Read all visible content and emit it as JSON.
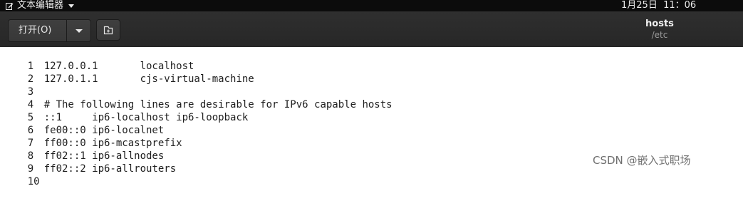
{
  "topbar": {
    "app_name": "文本编辑器",
    "clock": "1月25日  11：06"
  },
  "headerbar": {
    "open_label": "打开(O)",
    "title": "hosts",
    "subtitle": "/etc"
  },
  "editor": {
    "lines": [
      {
        "num": "1",
        "text": "127.0.0.1       localhost"
      },
      {
        "num": "2",
        "text": "127.0.1.1       cjs-virtual-machine"
      },
      {
        "num": "3",
        "text": ""
      },
      {
        "num": "4",
        "text": "# The following lines are desirable for IPv6 capable hosts"
      },
      {
        "num": "5",
        "text": "::1     ip6-localhost ip6-loopback"
      },
      {
        "num": "6",
        "text": "fe00::0 ip6-localnet"
      },
      {
        "num": "7",
        "text": "ff00::0 ip6-mcastprefix"
      },
      {
        "num": "8",
        "text": "ff02::1 ip6-allnodes"
      },
      {
        "num": "9",
        "text": "ff02::2 ip6-allrouters"
      },
      {
        "num": "10",
        "text": ""
      }
    ]
  },
  "watermark": "CSDN @嵌入式职场",
  "icons": {
    "app": "text-editor-icon",
    "menu_caret": "chevron-down-icon",
    "dropdown": "chevron-down-icon",
    "new_document": "new-document-icon"
  }
}
